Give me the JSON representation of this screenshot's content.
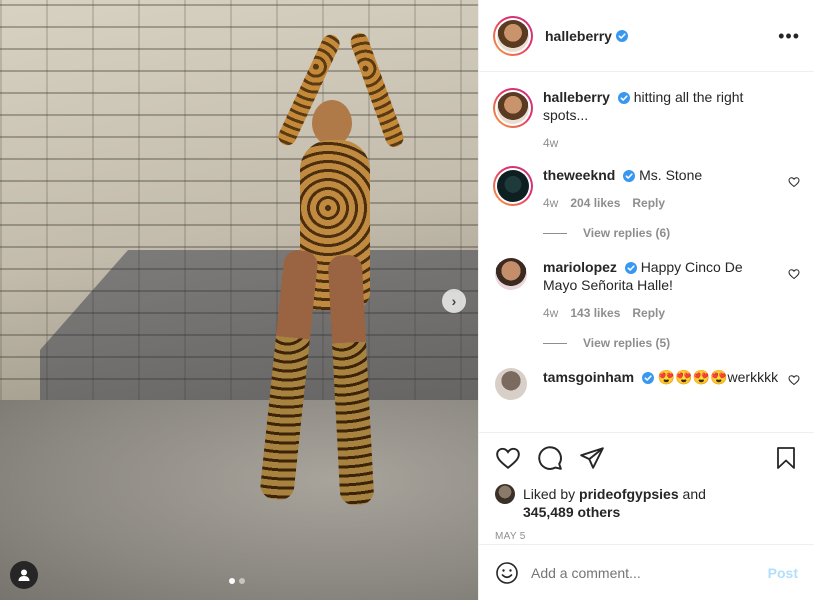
{
  "post": {
    "author": "halleberry",
    "verified": true
  },
  "media": {
    "slide_count": 2,
    "active_slide": 1,
    "next_arrow": "›"
  },
  "comments": [
    {
      "username": "halleberry",
      "text": "hitting all the right spots...",
      "time": "4w",
      "likes": "",
      "reply": "",
      "view_replies": ""
    },
    {
      "username": "theweeknd",
      "text": "Ms. Stone",
      "time": "4w",
      "likes": "204 likes",
      "reply": "Reply",
      "view_replies": "View replies (6)"
    },
    {
      "username": "mariolopez",
      "text": "Happy Cinco De Mayo Señorita Halle!",
      "time": "4w",
      "likes": "143 likes",
      "reply": "Reply",
      "view_replies": "View replies (5)"
    },
    {
      "username": "tamsgoinham",
      "text": "😍😍😍😍werkkkk",
      "time": "",
      "likes": "",
      "reply": "",
      "view_replies": ""
    }
  ],
  "actions": {
    "liked_by_prefix": "Liked by",
    "liked_by_user": "prideofgypsies",
    "and": "and",
    "others": "345,489 others",
    "date": "MAY 5"
  },
  "add_comment": {
    "placeholder": "Add a comment...",
    "post_label": "Post"
  },
  "colors": {
    "verified": "#3897f0",
    "post_button": "#b2dffc",
    "muted": "#8e8e8e"
  }
}
